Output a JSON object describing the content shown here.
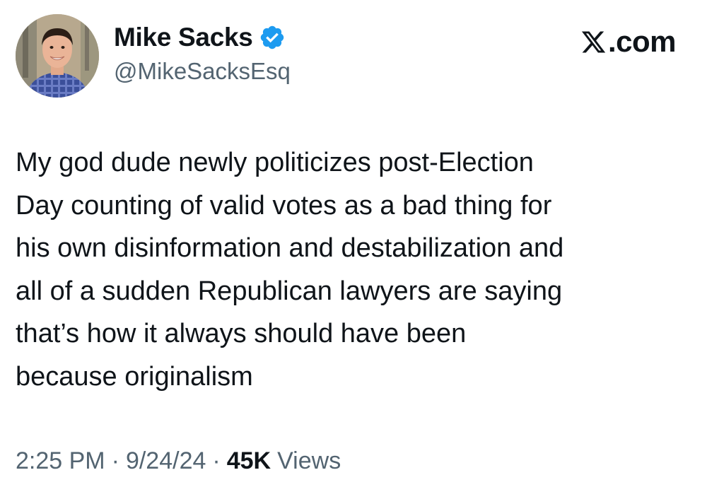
{
  "author": {
    "display_name": "Mike Sacks",
    "handle": "@MikeSacksEsq",
    "verified": true,
    "avatar_icon": "profile-photo"
  },
  "site": {
    "logo_icon": "x-logo-icon",
    "domain": ".com"
  },
  "tweet": {
    "lines": [
      "My god dude newly politicizes post-Election",
      "Day counting of valid votes as a bad thing for",
      "his own disinformation and destabilization and",
      "all of a sudden Republican lawyers are saying",
      "that’s how it always should have been",
      "because originalism"
    ]
  },
  "meta": {
    "time": "2:25 PM",
    "separator": "·",
    "date": "9/24/24",
    "view_count": "45K",
    "views_label": "Views"
  },
  "colors": {
    "text_primary": "#0f1419",
    "text_secondary": "#536471",
    "verified_blue": "#1d9bf0",
    "background": "#ffffff"
  }
}
